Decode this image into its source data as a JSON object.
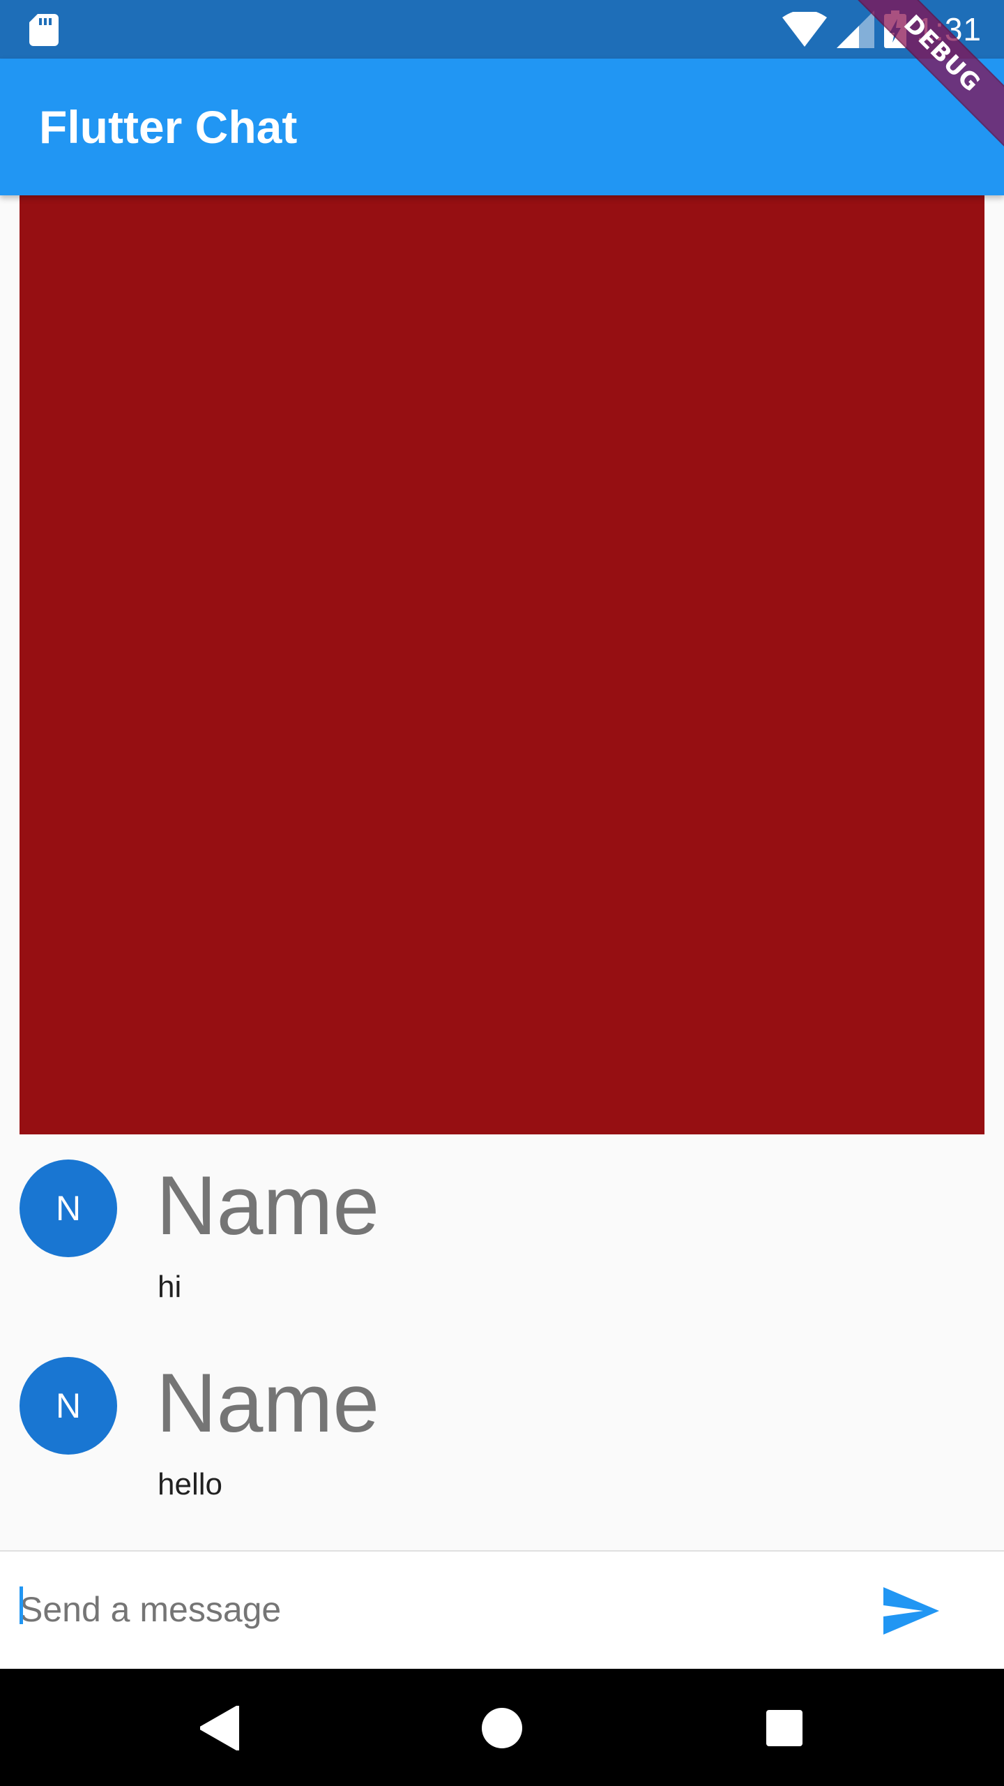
{
  "status_bar": {
    "time": "1:31",
    "icons": [
      "sd-card-icon",
      "wifi-icon",
      "signal-icon",
      "battery-charging-icon"
    ]
  },
  "app_bar": {
    "title": "Flutter Chat"
  },
  "debug_banner": {
    "label": "DEBUG"
  },
  "messages": [
    {
      "type": "image",
      "color": "#960f12"
    },
    {
      "type": "text",
      "avatar": "N",
      "name": "Name",
      "text": "hi"
    },
    {
      "type": "text",
      "avatar": "N",
      "name": "Name",
      "text": "hello"
    }
  ],
  "composer": {
    "placeholder": "Send a message",
    "value": "",
    "send_icon": "send-icon"
  },
  "nav_bar": {
    "icons": [
      "back-icon",
      "home-icon",
      "recents-icon"
    ]
  },
  "colors": {
    "status_bar": "#1e6eb8",
    "app_bar": "#2196f3",
    "avatar": "#1976d2",
    "accent": "#2196f3",
    "debug_banner": "#880e4f"
  }
}
